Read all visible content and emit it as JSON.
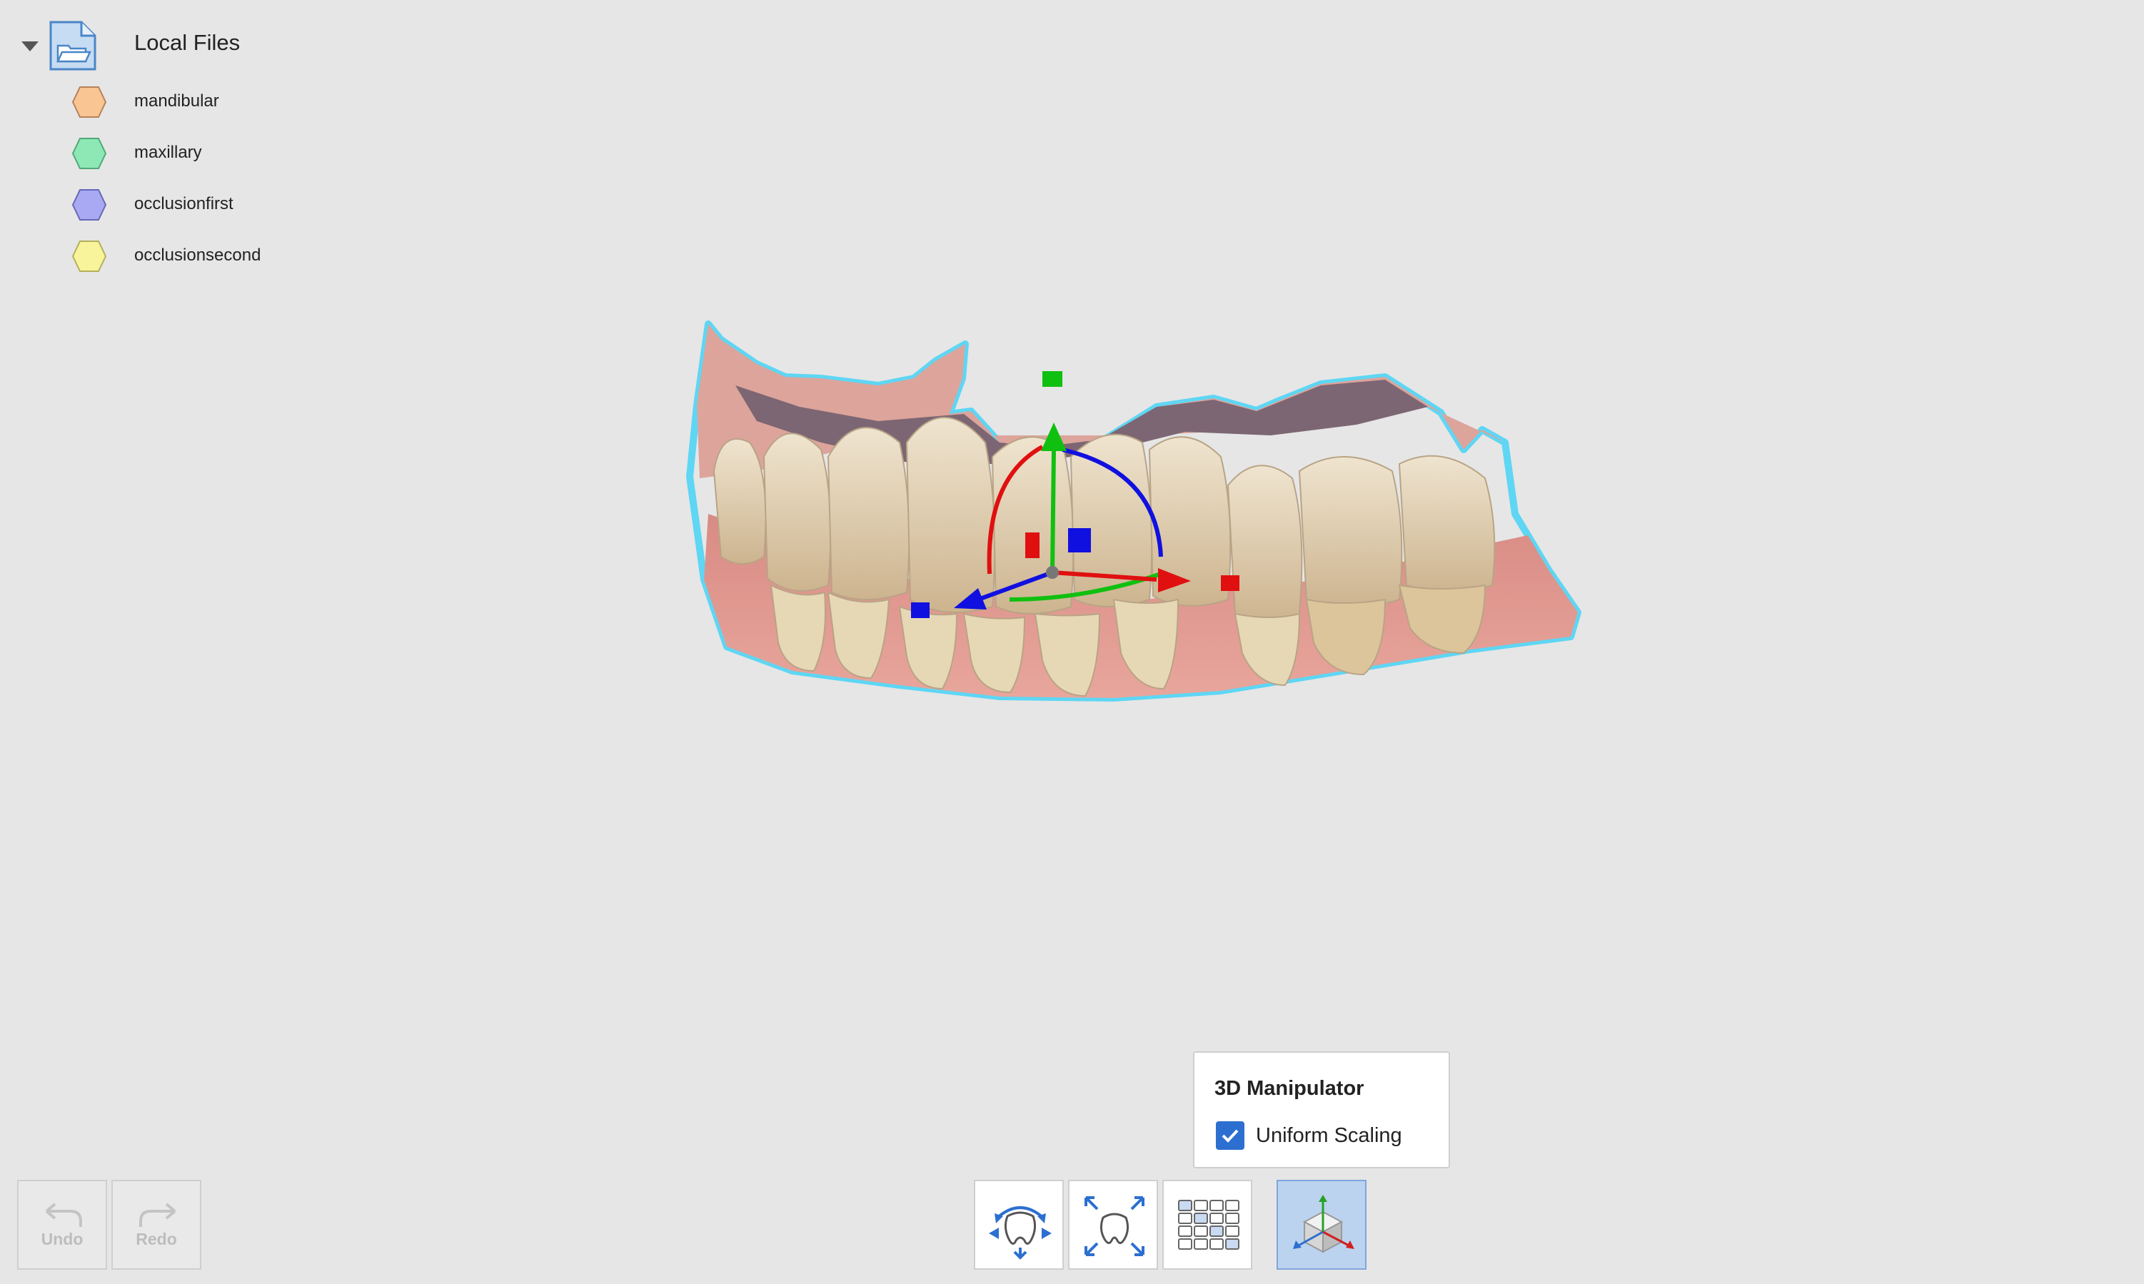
{
  "tree": {
    "root_label": "Local Files",
    "items": [
      {
        "label": "mandibular",
        "color": "#f9c592"
      },
      {
        "label": "maxillary",
        "color": "#8ee8b6"
      },
      {
        "label": "occlusionfirst",
        "color": "#a9a9f3"
      },
      {
        "label": "occlusionsecond",
        "color": "#f7f49c"
      }
    ]
  },
  "popup": {
    "title": "3D Manipulator",
    "checkbox_label": "Uniform Scaling",
    "checked": true
  },
  "history": {
    "undo_label": "Undo",
    "redo_label": "Redo"
  },
  "toolbar": {
    "tools": [
      {
        "icon": "rotate-tooth-icon"
      },
      {
        "icon": "scale-tooth-icon"
      },
      {
        "icon": "grid-icon"
      },
      {
        "icon": "3d-manipulator-icon",
        "active": true
      }
    ]
  },
  "colors": {
    "background": "#e6e6e6",
    "accent": "#2c6fd1",
    "selection_outline": "#4fd4f5",
    "axis_x": "#e01010",
    "axis_y": "#10c010",
    "axis_z": "#1010e0"
  }
}
